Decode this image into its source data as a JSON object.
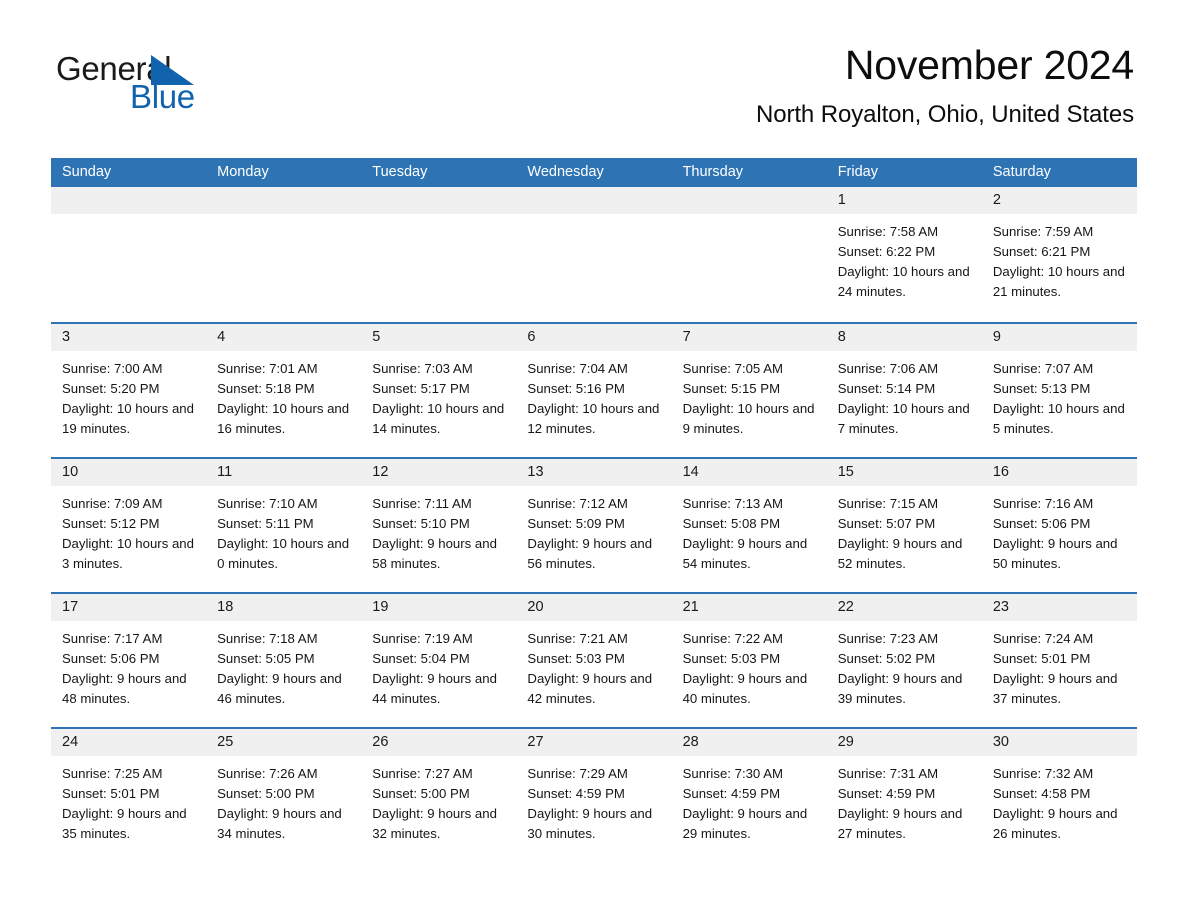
{
  "brand": {
    "name_part1": "General",
    "name_part2": "Blue",
    "accent_color": "#1163ad",
    "triangle_color": "#1163ad"
  },
  "header": {
    "month_title": "November 2024",
    "location": "North Royalton, Ohio, United States"
  },
  "theme": {
    "header_blue": "#2e74b5",
    "day_band_gray": "#f0f0f0",
    "cell_white": "#ffffff",
    "text_color": "#161616"
  },
  "calendar": {
    "weekdays": [
      "Sunday",
      "Monday",
      "Tuesday",
      "Wednesday",
      "Thursday",
      "Friday",
      "Saturday"
    ],
    "weeks": [
      [
        {
          "day": "",
          "empty": true
        },
        {
          "day": "",
          "empty": true
        },
        {
          "day": "",
          "empty": true
        },
        {
          "day": "",
          "empty": true
        },
        {
          "day": "",
          "empty": true
        },
        {
          "day": "1",
          "sunrise": "Sunrise: 7:58 AM",
          "sunset": "Sunset: 6:22 PM",
          "daylight": "Daylight: 10 hours and 24 minutes."
        },
        {
          "day": "2",
          "sunrise": "Sunrise: 7:59 AM",
          "sunset": "Sunset: 6:21 PM",
          "daylight": "Daylight: 10 hours and 21 minutes."
        }
      ],
      [
        {
          "day": "3",
          "sunrise": "Sunrise: 7:00 AM",
          "sunset": "Sunset: 5:20 PM",
          "daylight": "Daylight: 10 hours and 19 minutes."
        },
        {
          "day": "4",
          "sunrise": "Sunrise: 7:01 AM",
          "sunset": "Sunset: 5:18 PM",
          "daylight": "Daylight: 10 hours and 16 minutes."
        },
        {
          "day": "5",
          "sunrise": "Sunrise: 7:03 AM",
          "sunset": "Sunset: 5:17 PM",
          "daylight": "Daylight: 10 hours and 14 minutes."
        },
        {
          "day": "6",
          "sunrise": "Sunrise: 7:04 AM",
          "sunset": "Sunset: 5:16 PM",
          "daylight": "Daylight: 10 hours and 12 minutes."
        },
        {
          "day": "7",
          "sunrise": "Sunrise: 7:05 AM",
          "sunset": "Sunset: 5:15 PM",
          "daylight": "Daylight: 10 hours and 9 minutes."
        },
        {
          "day": "8",
          "sunrise": "Sunrise: 7:06 AM",
          "sunset": "Sunset: 5:14 PM",
          "daylight": "Daylight: 10 hours and 7 minutes."
        },
        {
          "day": "9",
          "sunrise": "Sunrise: 7:07 AM",
          "sunset": "Sunset: 5:13 PM",
          "daylight": "Daylight: 10 hours and 5 minutes."
        }
      ],
      [
        {
          "day": "10",
          "sunrise": "Sunrise: 7:09 AM",
          "sunset": "Sunset: 5:12 PM",
          "daylight": "Daylight: 10 hours and 3 minutes."
        },
        {
          "day": "11",
          "sunrise": "Sunrise: 7:10 AM",
          "sunset": "Sunset: 5:11 PM",
          "daylight": "Daylight: 10 hours and 0 minutes."
        },
        {
          "day": "12",
          "sunrise": "Sunrise: 7:11 AM",
          "sunset": "Sunset: 5:10 PM",
          "daylight": "Daylight: 9 hours and 58 minutes."
        },
        {
          "day": "13",
          "sunrise": "Sunrise: 7:12 AM",
          "sunset": "Sunset: 5:09 PM",
          "daylight": "Daylight: 9 hours and 56 minutes."
        },
        {
          "day": "14",
          "sunrise": "Sunrise: 7:13 AM",
          "sunset": "Sunset: 5:08 PM",
          "daylight": "Daylight: 9 hours and 54 minutes."
        },
        {
          "day": "15",
          "sunrise": "Sunrise: 7:15 AM",
          "sunset": "Sunset: 5:07 PM",
          "daylight": "Daylight: 9 hours and 52 minutes."
        },
        {
          "day": "16",
          "sunrise": "Sunrise: 7:16 AM",
          "sunset": "Sunset: 5:06 PM",
          "daylight": "Daylight: 9 hours and 50 minutes."
        }
      ],
      [
        {
          "day": "17",
          "sunrise": "Sunrise: 7:17 AM",
          "sunset": "Sunset: 5:06 PM",
          "daylight": "Daylight: 9 hours and 48 minutes."
        },
        {
          "day": "18",
          "sunrise": "Sunrise: 7:18 AM",
          "sunset": "Sunset: 5:05 PM",
          "daylight": "Daylight: 9 hours and 46 minutes."
        },
        {
          "day": "19",
          "sunrise": "Sunrise: 7:19 AM",
          "sunset": "Sunset: 5:04 PM",
          "daylight": "Daylight: 9 hours and 44 minutes."
        },
        {
          "day": "20",
          "sunrise": "Sunrise: 7:21 AM",
          "sunset": "Sunset: 5:03 PM",
          "daylight": "Daylight: 9 hours and 42 minutes."
        },
        {
          "day": "21",
          "sunrise": "Sunrise: 7:22 AM",
          "sunset": "Sunset: 5:03 PM",
          "daylight": "Daylight: 9 hours and 40 minutes."
        },
        {
          "day": "22",
          "sunrise": "Sunrise: 7:23 AM",
          "sunset": "Sunset: 5:02 PM",
          "daylight": "Daylight: 9 hours and 39 minutes."
        },
        {
          "day": "23",
          "sunrise": "Sunrise: 7:24 AM",
          "sunset": "Sunset: 5:01 PM",
          "daylight": "Daylight: 9 hours and 37 minutes."
        }
      ],
      [
        {
          "day": "24",
          "sunrise": "Sunrise: 7:25 AM",
          "sunset": "Sunset: 5:01 PM",
          "daylight": "Daylight: 9 hours and 35 minutes."
        },
        {
          "day": "25",
          "sunrise": "Sunrise: 7:26 AM",
          "sunset": "Sunset: 5:00 PM",
          "daylight": "Daylight: 9 hours and 34 minutes."
        },
        {
          "day": "26",
          "sunrise": "Sunrise: 7:27 AM",
          "sunset": "Sunset: 5:00 PM",
          "daylight": "Daylight: 9 hours and 32 minutes."
        },
        {
          "day": "27",
          "sunrise": "Sunrise: 7:29 AM",
          "sunset": "Sunset: 4:59 PM",
          "daylight": "Daylight: 9 hours and 30 minutes."
        },
        {
          "day": "28",
          "sunrise": "Sunrise: 7:30 AM",
          "sunset": "Sunset: 4:59 PM",
          "daylight": "Daylight: 9 hours and 29 minutes."
        },
        {
          "day": "29",
          "sunrise": "Sunrise: 7:31 AM",
          "sunset": "Sunset: 4:59 PM",
          "daylight": "Daylight: 9 hours and 27 minutes."
        },
        {
          "day": "30",
          "sunrise": "Sunrise: 7:32 AM",
          "sunset": "Sunset: 4:58 PM",
          "daylight": "Daylight: 9 hours and 26 minutes."
        }
      ]
    ]
  }
}
